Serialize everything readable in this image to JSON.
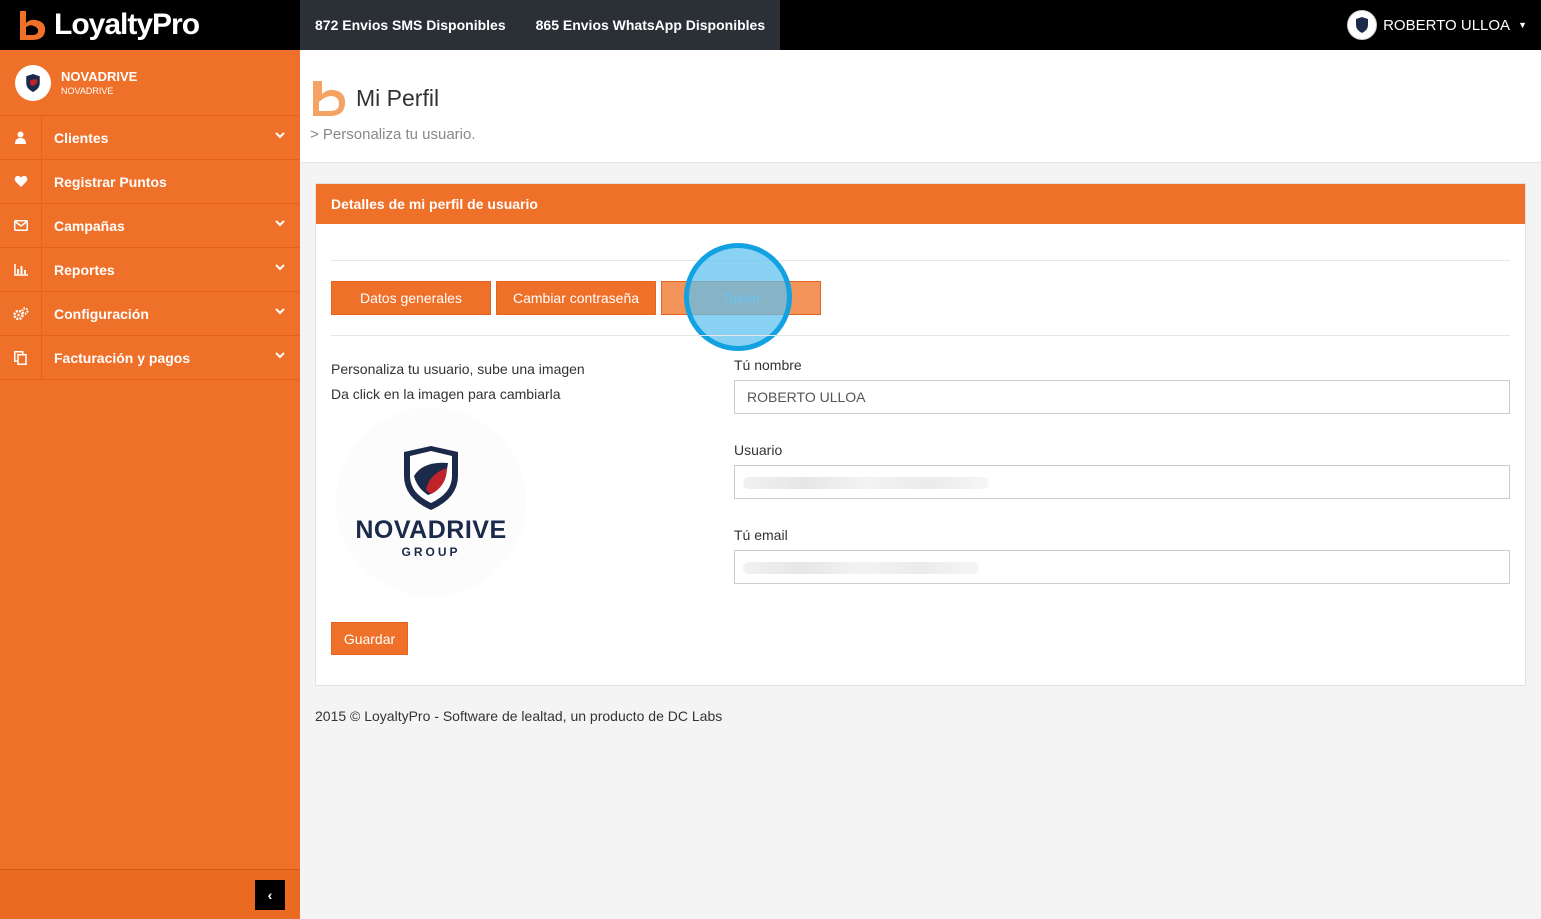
{
  "brand": {
    "name": "LoyaltyPro"
  },
  "credits": {
    "sms": "872 Envios SMS Disponibles",
    "whatsapp": "865 Envios WhatsApp Disponibles"
  },
  "user_menu": {
    "name": "ROBERTO ULLOA"
  },
  "company": {
    "name": "NOVADRIVE",
    "subname": "NOVADRIVE"
  },
  "sidebar": {
    "items": [
      {
        "label": "Clientes",
        "icon": "user-icon",
        "has_submenu": true
      },
      {
        "label": "Registrar Puntos",
        "icon": "heart-icon",
        "has_submenu": false
      },
      {
        "label": "Campañas",
        "icon": "envelope-icon",
        "has_submenu": true
      },
      {
        "label": "Reportes",
        "icon": "bar-chart-icon",
        "has_submenu": true
      },
      {
        "label": "Configuración",
        "icon": "cogs-icon",
        "has_submenu": true
      },
      {
        "label": "Facturación y pagos",
        "icon": "copy-icon",
        "has_submenu": true
      }
    ]
  },
  "page": {
    "title": "Mi Perfil",
    "subtitle": "> Personaliza tu usuario."
  },
  "panel": {
    "heading": "Detalles de mi perfil de usuario",
    "tabs": [
      {
        "label": "Datos generales"
      },
      {
        "label": "Cambiar contraseña"
      },
      {
        "label": "Token"
      }
    ],
    "help_line_1": "Personaliza tu usuario, sube una imagen",
    "help_line_2": "Da click en la imagen para cambiarla",
    "logo": {
      "word": "NOVADRIVE",
      "group": "GROUP"
    },
    "fields": {
      "name_label": "Tú nombre",
      "name_value": "ROBERTO ULLOA",
      "user_label": "Usuario",
      "email_label": "Tú email"
    },
    "save_label": "Guardar"
  },
  "footer": {
    "text": "2015 © LoyaltyPro - Software de lealtad, un producto de DC Labs"
  },
  "colors": {
    "accent": "#ef7028",
    "topbar": "#000000",
    "credits_bg": "#2b2f36",
    "click_ring": "#12a1e1"
  }
}
